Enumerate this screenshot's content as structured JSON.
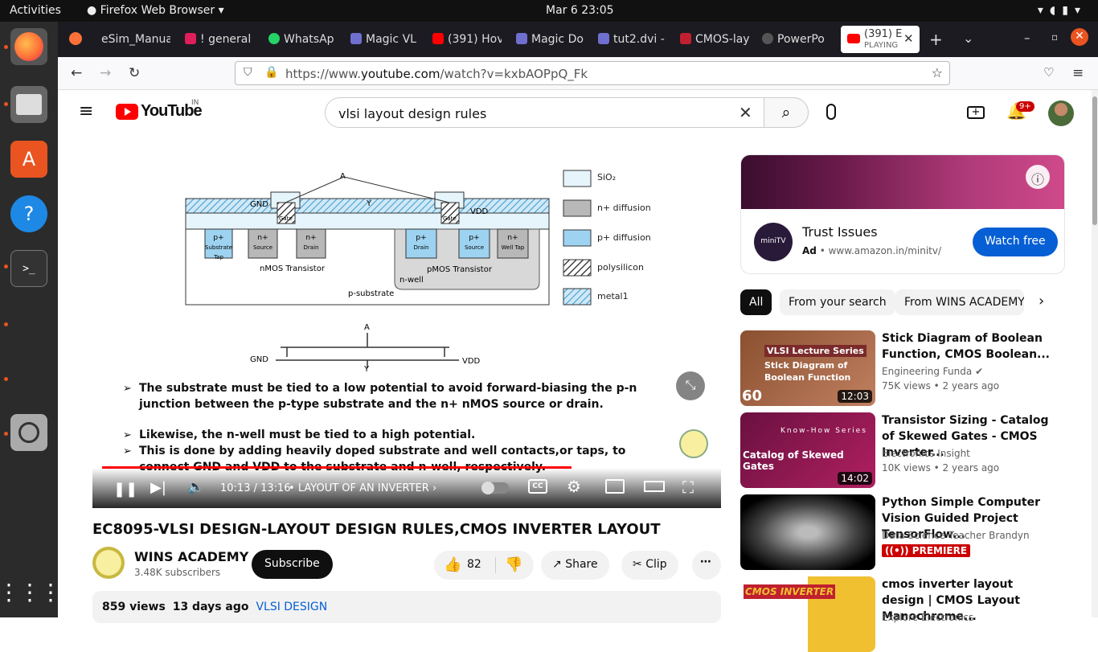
{
  "system": {
    "activities": "Activities",
    "app_name": "Firefox Web Browser",
    "clock": "Mar 6  23:05"
  },
  "tabs": [
    {
      "label": "eSim_Manua",
      "color": "#888"
    },
    {
      "label": "! general",
      "color": "#e01e5a"
    },
    {
      "label": "WhatsAp",
      "color": "#25d366"
    },
    {
      "label": "Magic VL",
      "color": "#6f6fd0"
    },
    {
      "label": "(391) Hov",
      "color": "#f00"
    },
    {
      "label": "Magic Do",
      "color": "#6f6fd0"
    },
    {
      "label": "tut2.dvi -",
      "color": "#6f6fd0"
    },
    {
      "label": "CMOS-lay",
      "color": "#c02030"
    },
    {
      "label": "PowerPo",
      "color": "#555"
    }
  ],
  "active_tab": {
    "title": "(391) E",
    "subtitle": "PLAYING"
  },
  "url": {
    "prefix": "https://www.",
    "domain": "youtube.com",
    "path": "/watch?v=kxbAOPpQ_Fk"
  },
  "youtube": {
    "logo": "YouTube",
    "country": "IN",
    "search_value": "vlsi layout design rules",
    "notif_count": "9+"
  },
  "player": {
    "time": "10:13 / 13:16",
    "chapter": "LAYOUT OF AN INVERTER",
    "progress": 0.77,
    "slide": {
      "legend": [
        "SiO₂",
        "n+ diffusion",
        "p+ diffusion",
        "polysilicon",
        "metal1"
      ],
      "labels": {
        "gnd": "GND",
        "vdd": "VDD",
        "a": "A",
        "y": "Y",
        "gate": "Gate",
        "nmos": "nMOS Transistor",
        "pmos": "pMOS Transistor",
        "nwell": "n-well",
        "psub": "p-substrate"
      },
      "regions": [
        {
          "t": "p+",
          "b": "Substrate Tap"
        },
        {
          "t": "n+",
          "b": "Source"
        },
        {
          "t": "n+",
          "b": "Drain"
        },
        {
          "t": "p+",
          "b": "Drain"
        },
        {
          "t": "p+",
          "b": "Source"
        },
        {
          "t": "n+",
          "b": "Well Tap"
        }
      ],
      "bullets": [
        "The substrate must be tied to a low potential to avoid forward-biasing the p-n junction between the p-type substrate and the n+ nMOS source or drain.",
        "Likewise, the n-well must be tied to a high potential.",
        "This is done by adding heavily doped substrate and well contacts,or taps, to connect GND and VDD to the substrate and n-well, respectively."
      ]
    }
  },
  "video": {
    "title": "EC8095-VLSI DESIGN-LAYOUT DESIGN RULES,CMOS INVERTER LAYOUT",
    "channel": "WINS ACADEMY",
    "subscribers": "3.48K subscribers",
    "subscribe": "Subscribe",
    "likes": "82",
    "share": "Share",
    "clip": "Clip",
    "views": "859 views",
    "age": "13 days ago",
    "tag": "VLSI DESIGN"
  },
  "ad": {
    "title": "Trust Issues",
    "badge": "Ad",
    "domain": "www.amazon.in/minitv/",
    "cta": "Watch free",
    "logo": "miniTV"
  },
  "chips": [
    "All",
    "From your search",
    "From WINS ACADEMY"
  ],
  "recommendations": [
    {
      "title": "Stick Diagram of Boolean Function, CMOS Boolean...",
      "channel": "Engineering Funda",
      "meta": "75K views  • 2 years ago",
      "duration": "12:03",
      "thumb_text": "Stick Diagram of Boolean Function",
      "thumb_head": "VLSI Lecture Series",
      "badge": "60"
    },
    {
      "title": "Transistor Sizing - Catalog of Skewed Gates - CMOS Inverter...",
      "channel": "Electronics Insight",
      "meta": "10K views  • 2 years ago",
      "duration": "14:02",
      "thumb_text": "Catalog of Skewed Gates",
      "thumb_head": "Know-How Series"
    },
    {
      "title": "Python Simple Computer Vision Guided Project TensorFlow...",
      "channel": "Data Science Teacher Brandyn",
      "meta": "PREMIERE"
    },
    {
      "title": "cmos inverter layout design | CMOS Layout Manochrome...",
      "channel": "Explore Electronics",
      "thumb_text": "CMOS INVERTER"
    }
  ]
}
